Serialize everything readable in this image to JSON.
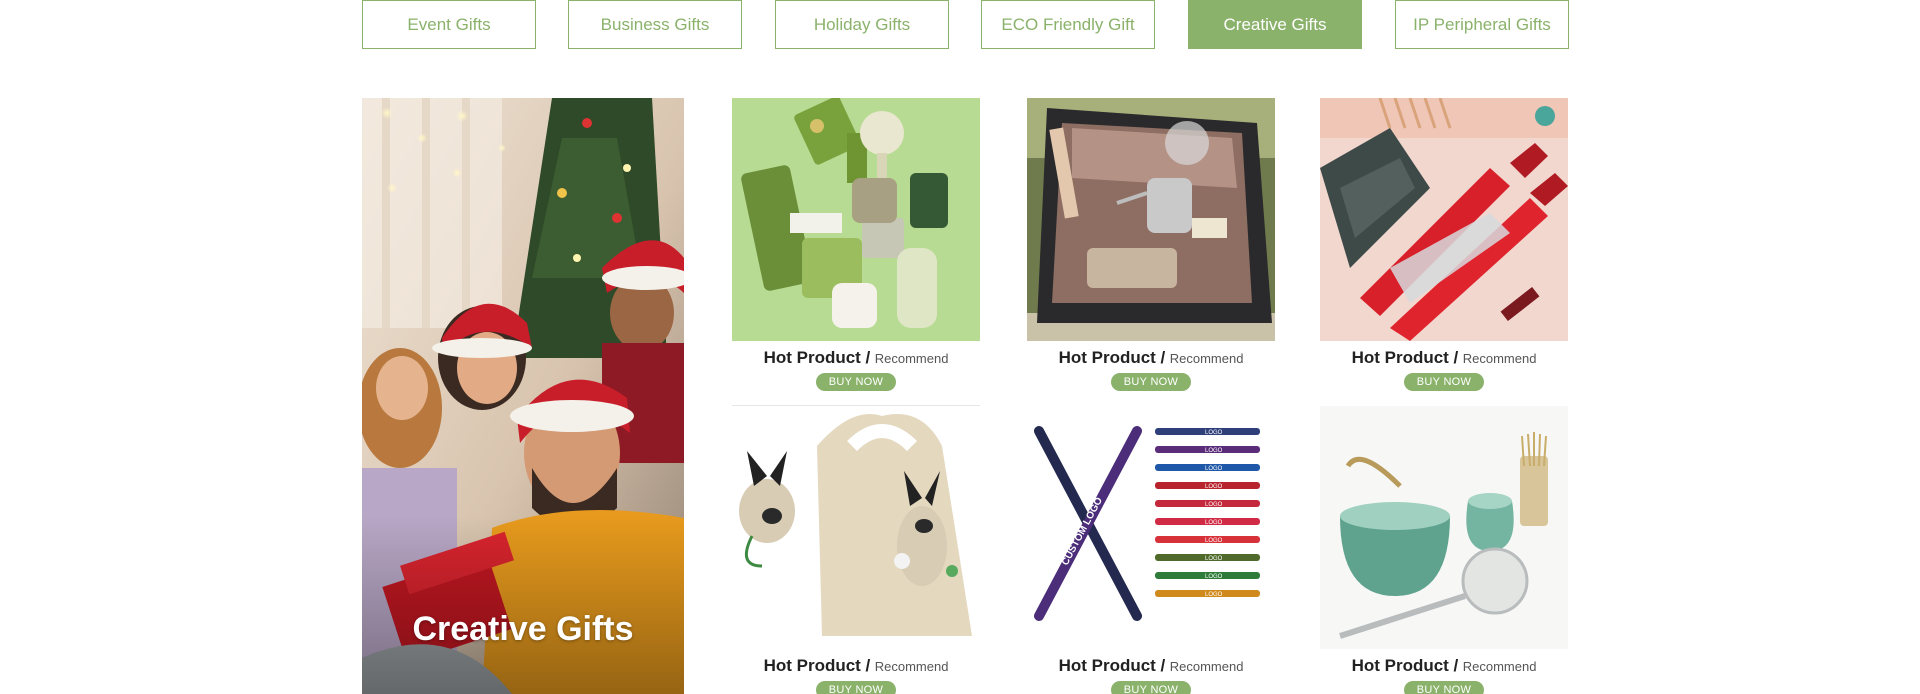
{
  "tabs": [
    {
      "label": "Event Gifts",
      "active": false
    },
    {
      "label": "Business Gifts",
      "active": false
    },
    {
      "label": "Holiday Gifts",
      "active": false
    },
    {
      "label": "ECO Friendly Gift",
      "active": false
    },
    {
      "label": "Creative Gifts",
      "active": true
    },
    {
      "label": "IP Peripheral Gifts",
      "active": false
    }
  ],
  "hero": {
    "title": "Creative Gifts"
  },
  "products": [
    {
      "hot": "Hot Product /",
      "rec": "Recommend",
      "buy": "BUY NOW",
      "image": "green-gift-set"
    },
    {
      "hot": "Hot Product /",
      "rec": "Recommend",
      "buy": "BUY NOW",
      "image": "coffee-travel-kit"
    },
    {
      "hot": "Hot Product /",
      "rec": "Recommend",
      "buy": "BUY NOW",
      "image": "wine-bottle-umbrella"
    },
    {
      "hot": "Hot Product /",
      "rec": "Recommend",
      "buy": "BUY NOW",
      "image": "dog-shopping-bag"
    },
    {
      "hot": "Hot Product /",
      "rec": "Recommend",
      "buy": "BUY NOW",
      "image": "logo-pens"
    },
    {
      "hot": "Hot Product /",
      "rec": "Recommend",
      "buy": "BUY NOW",
      "image": "matcha-tea-set"
    }
  ],
  "pen_texts": {
    "cross": "CUSTOM LOGO",
    "small": "LOGO"
  },
  "colors": {
    "accent": "#8ab26b",
    "text": "#222222"
  }
}
